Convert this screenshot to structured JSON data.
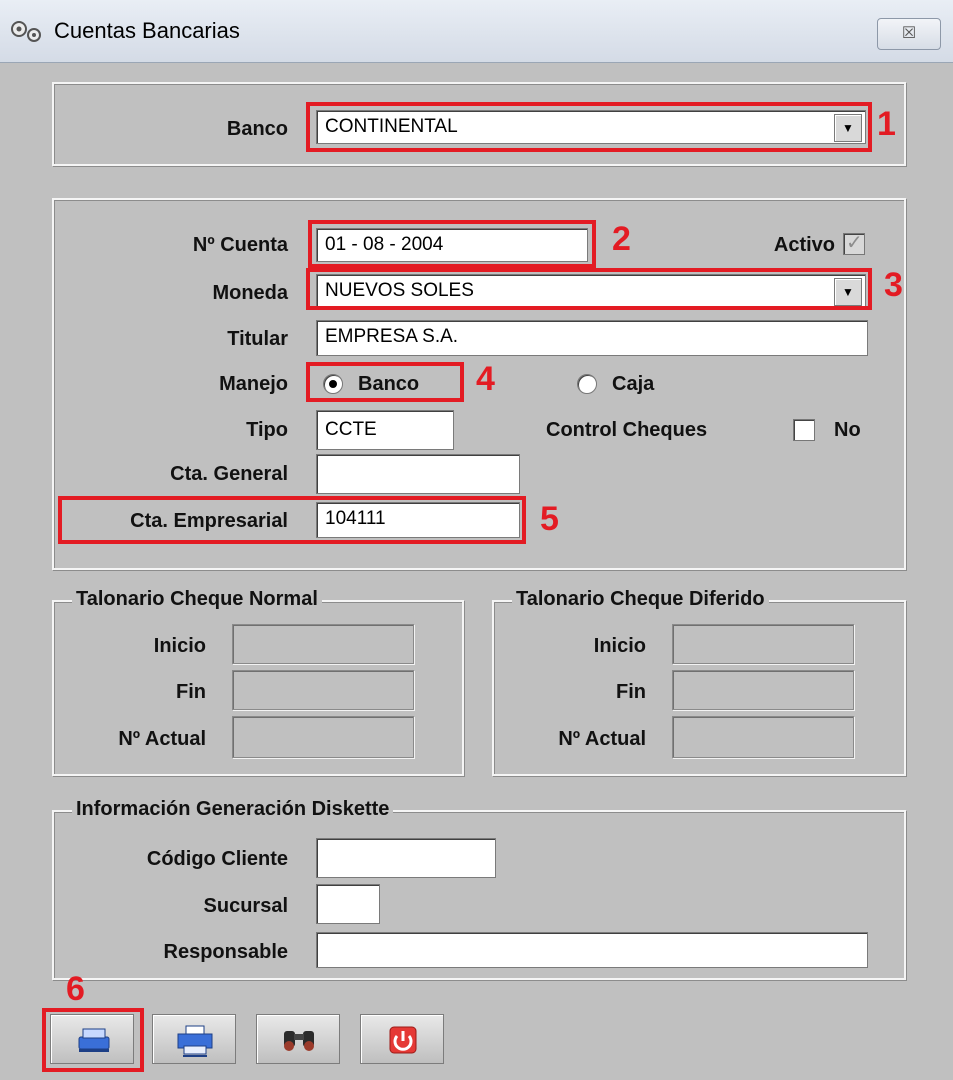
{
  "window": {
    "title": "Cuentas Bancarias",
    "close_label": "☒"
  },
  "banco": {
    "label": "Banco",
    "value": "CONTINENTAL"
  },
  "cuenta": {
    "numero_label": "Nº Cuenta",
    "numero_value": "01 - 08 - 2004",
    "activo_label": "Activo",
    "activo_checked": true,
    "moneda_label": "Moneda",
    "moneda_value": "NUEVOS SOLES",
    "titular_label": "Titular",
    "titular_value": "EMPRESA S.A.",
    "manejo_label": "Manejo",
    "manejo_banco_label": "Banco",
    "manejo_caja_label": "Caja",
    "manejo_selected": "Banco",
    "tipo_label": "Tipo",
    "tipo_value": "CCTE",
    "control_cheques_label": "Control Cheques",
    "control_cheques_value_label": "No",
    "cta_general_label": "Cta. General",
    "cta_general_value": "",
    "cta_empresarial_label": "Cta. Empresarial",
    "cta_empresarial_value": "104111"
  },
  "talonario_normal": {
    "title": "Talonario Cheque Normal",
    "inicio_label": "Inicio",
    "fin_label": "Fin",
    "actual_label": "Nº Actual"
  },
  "talonario_diferido": {
    "title": "Talonario Cheque Diferido",
    "inicio_label": "Inicio",
    "fin_label": "Fin",
    "actual_label": "Nº Actual"
  },
  "diskette": {
    "title": "Información Generación Diskette",
    "codigo_cliente_label": "Código Cliente",
    "codigo_cliente_value": "",
    "sucursal_label": "Sucursal",
    "sucursal_value": "",
    "responsable_label": "Responsable",
    "responsable_value": ""
  },
  "annotations": {
    "m1": "1",
    "m2": "2",
    "m3": "3",
    "m4": "4",
    "m5": "5",
    "m6": "6"
  },
  "toolbar": {
    "buttons": [
      {
        "icon": "save-disk-icon"
      },
      {
        "icon": "printer-icon"
      },
      {
        "icon": "binoculars-icon"
      },
      {
        "icon": "power-exit-icon"
      }
    ]
  },
  "colors": {
    "dialog_bg": "#c0c0c0",
    "annotation_red": "#e31b23"
  }
}
